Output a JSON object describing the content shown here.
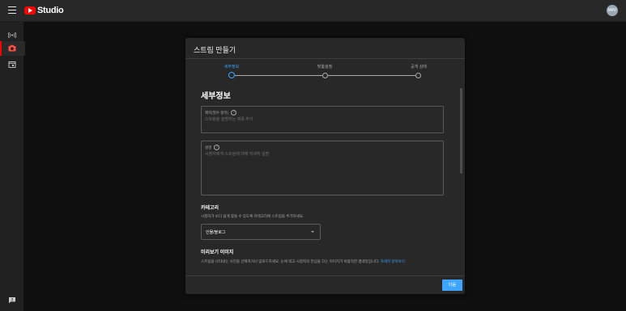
{
  "topbar": {
    "app_name": "Studio",
    "avatar_initials": "M4V",
    "icons": {
      "menu": "hamburger-icon",
      "logo": "youtube-logo-icon"
    }
  },
  "sidebar": {
    "items": [
      {
        "id": "stream",
        "icon": "broadcast-icon",
        "active": false
      },
      {
        "id": "webcam",
        "icon": "camera-icon",
        "active": true
      },
      {
        "id": "manage",
        "icon": "calendar-icon",
        "active": false
      },
      {
        "id": "feedback",
        "icon": "feedback-icon",
        "active": false
      }
    ]
  },
  "dialog": {
    "title": "스트림 만들기",
    "steps": [
      {
        "label": "세부정보",
        "active": true
      },
      {
        "label": "맞춤설정",
        "active": false
      },
      {
        "label": "공개 상태",
        "active": false
      }
    ],
    "section_title": "세부정보",
    "title_field": {
      "label": "제목(필수 항목)",
      "placeholder": "스트림을 설명하는 제목 추가"
    },
    "description_field": {
      "label": "설명",
      "placeholder": "시청자에게 스트림에 대해 자세히 설명"
    },
    "category": {
      "title": "카테고리",
      "description": "시청자가 보다 쉽게 찾을 수 있도록 카테고리에 스트림을 추가하세요.",
      "selected": "인물/블로그"
    },
    "thumbnail": {
      "title": "미리보기 이미지",
      "description": "스트림을 나타내는 사진을 선택하거나 업로드하세요. 눈에 띄고 시청자의 관심을 끄는 이미지가 바람직한 썸네일입니다.",
      "link": "자세히 알아보기"
    },
    "next_button": "다음"
  },
  "colors": {
    "accent": "#3ea6ff",
    "brand": "#ff0000",
    "background": "#0f0f0f",
    "dialog": "#282828"
  }
}
